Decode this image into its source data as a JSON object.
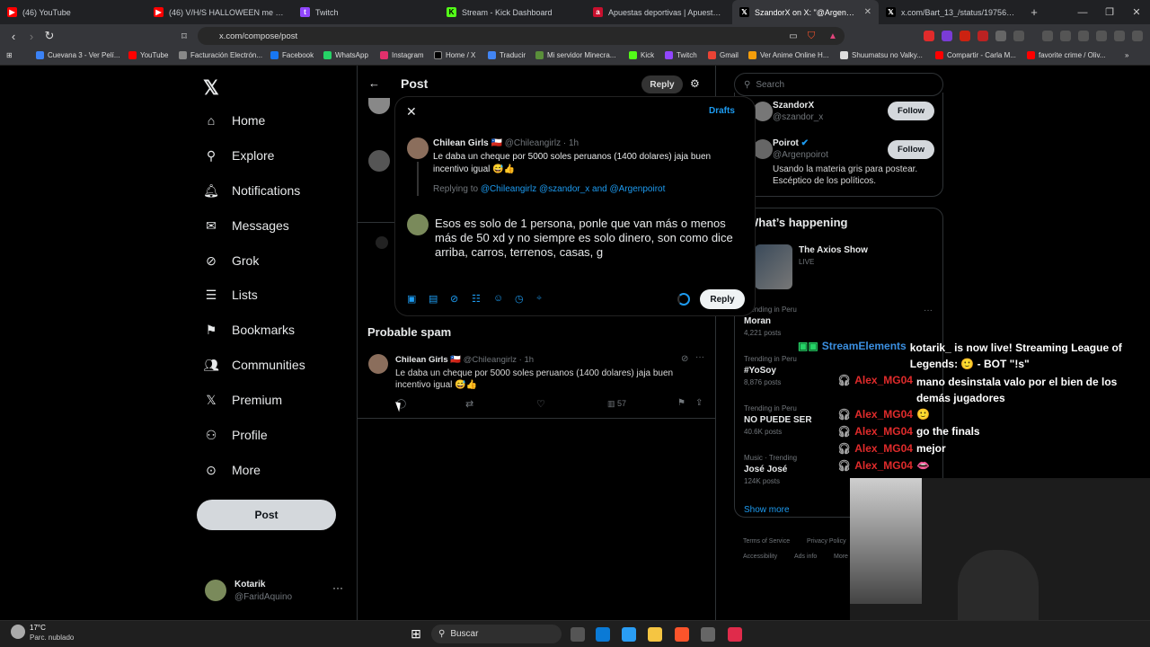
{
  "browser": {
    "tabs": [
      {
        "title": "(46) YouTube",
        "icon": "youtube-icon",
        "color": "#ff0000"
      },
      {
        "title": "(46) V/H/S HALLOWEEN me dio mie",
        "icon": "youtube-icon",
        "color": "#ff0000"
      },
      {
        "title": "Twitch",
        "icon": "twitch-icon",
        "color": "#9146ff"
      },
      {
        "title": "Stream - Kick Dashboard",
        "icon": "kick-icon",
        "color": "#53fc18"
      },
      {
        "title": "Apuestas deportivas | Apuestas onlin",
        "icon": "bet-icon",
        "color": "#c8102e"
      },
      {
        "title": "SzandorX on X: \"@Argenpoirot",
        "icon": "x-icon",
        "color": "#000000",
        "active": true
      },
      {
        "title": "x.com/Bart_13_/status/19756405047",
        "icon": "x-icon",
        "color": "#000000"
      }
    ],
    "url": "x.com/compose/post",
    "bookmarks": [
      "Cuevana 3 - Ver Pelí...",
      "YouTube",
      "Facturación Electrón...",
      "Facebook",
      "WhatsApp",
      "Instagram",
      "Home / X",
      "Traducir",
      "Mi servidor Minecra...",
      "Kick",
      "Twitch",
      "Gmail",
      "Ver Anime Online H...",
      "Shuumatsu no Valky...",
      "Compartir - Carla M...",
      "favorite crime / Oliv..."
    ]
  },
  "nav": {
    "items": [
      "Home",
      "Explore",
      "Notifications",
      "Messages",
      "Grok",
      "Lists",
      "Bookmarks",
      "Communities",
      "Premium",
      "Profile",
      "More"
    ],
    "post_label": "Post",
    "account_name": "Kotarik",
    "account_handle": "@FaridAquino"
  },
  "header": {
    "title": "Post",
    "reply_label": "Reply"
  },
  "search": {
    "placeholder": "Search"
  },
  "follow_suggestions": [
    {
      "name": "SzandorX",
      "handle": "@szandor_x",
      "button": "Follow"
    },
    {
      "name": "Poirot",
      "handle": "@Argenpoirot",
      "bio": "Usando la materia gris para postear. Escéptico de los políticos.",
      "button": "Follow"
    }
  ],
  "happening": {
    "title": "What’s happening",
    "live": {
      "name": "The Axios Show",
      "status": "LIVE"
    },
    "trends": [
      {
        "context": "Trending in Peru",
        "name": "Moran",
        "posts": "4,221 posts"
      },
      {
        "context": "Trending in Peru",
        "name": "#YoSoy",
        "posts": "8,876 posts"
      },
      {
        "context": "Trending in Peru",
        "name": "NO PUEDE SER",
        "posts": "40.6K posts"
      },
      {
        "context": "Music · Trending",
        "name": "José José",
        "posts": "124K posts"
      }
    ],
    "show_more": "Show more"
  },
  "footer_links": [
    "Terms of Service",
    "Privacy Policy",
    "Accessibility",
    "Ads info",
    "More"
  ],
  "modal": {
    "drafts": "Drafts",
    "original": {
      "name": "Chilean Girls",
      "flag": "🇨🇱",
      "handle": "@Chileangirlz",
      "time": "· 1h",
      "text": "Le daba un cheque por 5000 soles peruanos (1400 dolares) jaja buen incentivo igual 😅👍"
    },
    "replying_prefix": "Replying to ",
    "replying_to": "@Chileangirlz @szandor_x and @Argenpoirot",
    "compose_text": "Esos es solo de 1 persona, ponle que van más o menos más de 50 xd y no siempre es solo dinero, son como dice arriba, carros, terrenos, casas, g",
    "reply_button": "Reply"
  },
  "feed": {
    "section_title": "Probable spam",
    "post": {
      "name": "Chilean Girls",
      "flag": "🇨🇱",
      "handle": "@Chileangirlz",
      "time": "· 1h",
      "text": "Le daba un cheque por 5000 soles peruanos (1400 dolares) jaja buen incentivo igual 😅👍",
      "views": "57"
    }
  },
  "stream_chat": [
    {
      "user": "StreamElements",
      "user_color": "#1e90ff",
      "msg": "kotarik_ is now live! Streaming League of Legends: 🙂 - BOT \"!s\""
    },
    {
      "user": "Alex_MG04",
      "user_color": "#e02b2b",
      "msg": "mano desinstala valo por el bien de los demás jugadores"
    },
    {
      "user": "Alex_MG04",
      "user_color": "#e02b2b",
      "msg": "🙂"
    },
    {
      "user": "Alex_MG04",
      "user_color": "#e02b2b",
      "msg": "go the finals"
    },
    {
      "user": "Alex_MG04",
      "user_color": "#e02b2b",
      "msg": "mejor"
    },
    {
      "user": "Alex_MG04",
      "user_color": "#e02b2b",
      "msg": "👄"
    }
  ],
  "taskbar": {
    "temp": "17°C",
    "weather": "Parc. nublado",
    "search": "Buscar"
  }
}
